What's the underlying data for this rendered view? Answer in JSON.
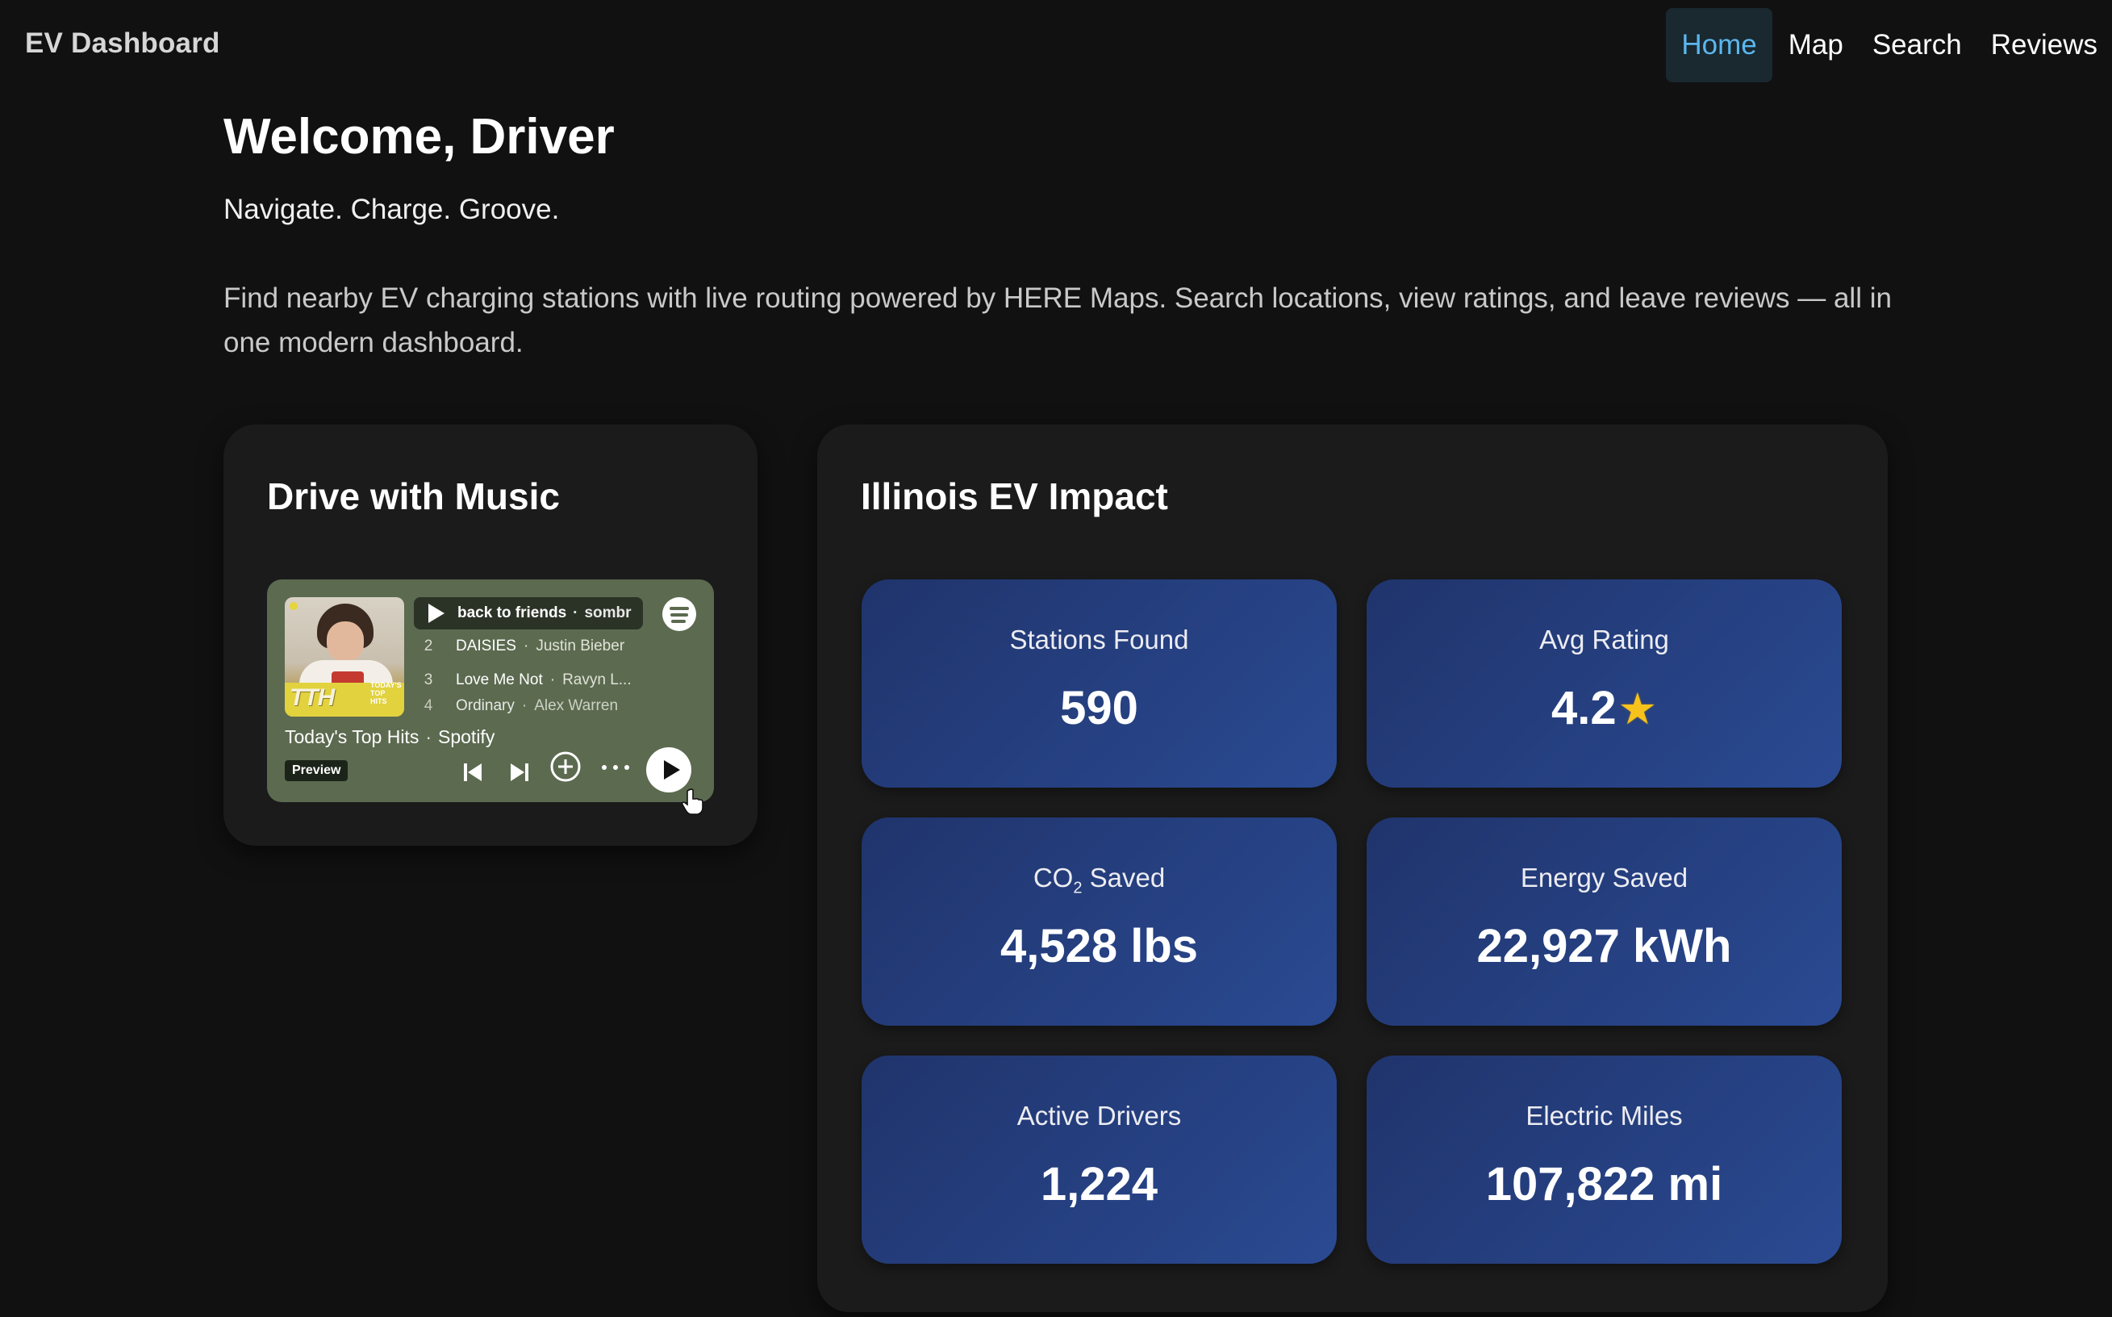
{
  "nav": {
    "brand": "EV Dashboard",
    "items": [
      "Home",
      "Map",
      "Search",
      "Reviews"
    ],
    "active": "Home"
  },
  "hero": {
    "title": "Welcome, Driver",
    "tagline": "Navigate. Charge. Groove.",
    "description": "Find nearby EV charging stations with live routing powered by HERE Maps. Search locations, view ratings, and leave reviews — all in one modern dashboard."
  },
  "music": {
    "title": "Drive with Music",
    "player": {
      "cover_text": "TTH",
      "cover_small": "TODAY'S TOP HITS",
      "now_playing": {
        "title": "back to friends",
        "artist": "sombr"
      },
      "tracks": [
        {
          "n": "2",
          "title": "DAISIES",
          "artist": "Justin Bieber"
        },
        {
          "n": "3",
          "title": "Love Me Not",
          "artist": "Ravyn L..."
        },
        {
          "n": "4",
          "title": "Ordinary",
          "artist": "Alex Warren"
        }
      ],
      "playlist": "Today's Top Hits",
      "source": "Spotify",
      "badge": "Preview"
    }
  },
  "impact": {
    "title": "Illinois EV Impact",
    "stats": [
      {
        "label": "Stations Found",
        "value": "590"
      },
      {
        "label": "Avg Rating",
        "value": "4.2",
        "icon": "star-icon",
        "icon_glyph": "★"
      },
      {
        "label": "CO",
        "label_sub": "2",
        "label_suffix": " Saved",
        "value": "4,528 lbs"
      },
      {
        "label": "Energy Saved",
        "value": "22,927 kWh"
      },
      {
        "label": "Active Drivers",
        "value": "1,224"
      },
      {
        "label": "Electric Miles",
        "value": "107,822 mi"
      }
    ]
  },
  "colors": {
    "background": "#111111",
    "card": "#1b1b1b",
    "nav_active": "#5ab8ee",
    "tile_from": "#20346c",
    "tile_to": "#2a4a92",
    "player": "#5c6a50"
  }
}
